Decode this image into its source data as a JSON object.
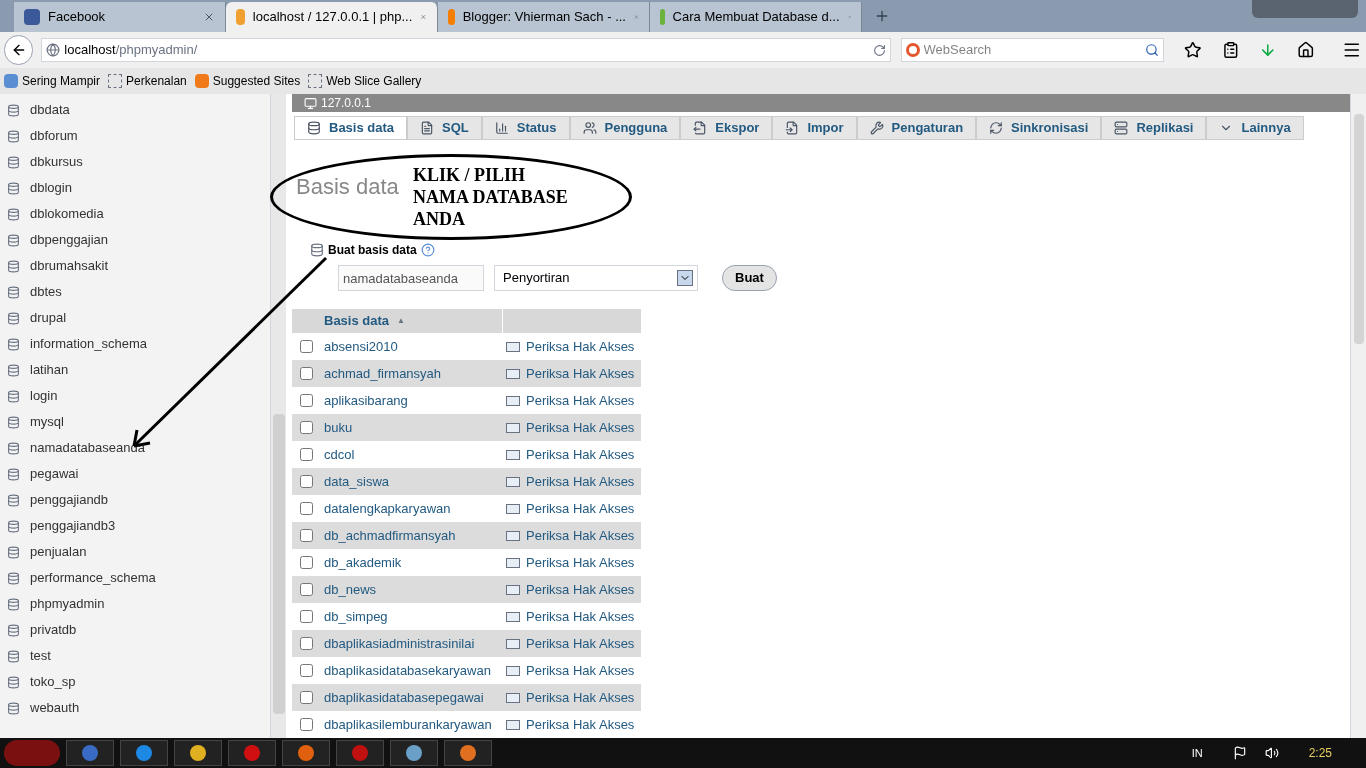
{
  "browser": {
    "tabs": [
      {
        "title": "Facebook",
        "selected": false
      },
      {
        "title": "localhost / 127.0.0.1 | php...",
        "selected": true
      },
      {
        "title": "Blogger: Vhierman Sach - ...",
        "selected": false
      },
      {
        "title": "Cara Membuat Database d...",
        "selected": false
      }
    ],
    "address": {
      "host": "localhost",
      "path": "/phpmyadmin/"
    },
    "search": {
      "placeholder": "WebSearch"
    },
    "bookmarks": [
      "Sering Mampir",
      "Perkenalan",
      "Suggested Sites",
      "Web Slice Gallery"
    ]
  },
  "sidebar": {
    "items": [
      "dbdata",
      "dbforum",
      "dbkursus",
      "dblogin",
      "dblokomedia",
      "dbpenggajian",
      "dbrumahsakit",
      "dbtes",
      "drupal",
      "information_schema",
      "latihan",
      "login",
      "mysql",
      "namadatabaseanda",
      "pegawai",
      "penggajiandb",
      "penggajiandb3",
      "penjualan",
      "performance_schema",
      "phpmyadmin",
      "privatdb",
      "test",
      "toko_sp",
      "webauth"
    ]
  },
  "server": "127.0.0.1",
  "tabs": [
    {
      "label": "Basis data",
      "selected": true
    },
    {
      "label": "SQL",
      "selected": false
    },
    {
      "label": "Status",
      "selected": false
    },
    {
      "label": "Pengguna",
      "selected": false
    },
    {
      "label": "Ekspor",
      "selected": false
    },
    {
      "label": "Impor",
      "selected": false
    },
    {
      "label": "Pengaturan",
      "selected": false
    },
    {
      "label": "Sinkronisasi",
      "selected": false
    },
    {
      "label": "Replikasi",
      "selected": false
    },
    {
      "label": "Lainnya",
      "selected": false
    }
  ],
  "heading": "Basis data",
  "create": {
    "label": "Buat basis data",
    "name_value": "namadatabaseanda",
    "collation": "Penyortiran",
    "button": "Buat"
  },
  "table": {
    "column": "Basis data",
    "sort_indicator": "▲",
    "rows": [
      {
        "name": "absensi2010",
        "checked": false,
        "action": "Periksa Hak Akses"
      },
      {
        "name": "achmad_firmansyah",
        "checked": false,
        "action": "Periksa Hak Akses"
      },
      {
        "name": "aplikasibarang",
        "checked": false,
        "action": "Periksa Hak Akses"
      },
      {
        "name": "buku",
        "checked": false,
        "action": "Periksa Hak Akses"
      },
      {
        "name": "cdcol",
        "checked": false,
        "action": "Periksa Hak Akses"
      },
      {
        "name": "data_siswa",
        "checked": false,
        "action": "Periksa Hak Akses"
      },
      {
        "name": "datalengkapkaryawan",
        "checked": false,
        "action": "Periksa Hak Akses"
      },
      {
        "name": "db_achmadfirmansyah",
        "checked": false,
        "action": "Periksa Hak Akses"
      },
      {
        "name": "db_akademik",
        "checked": false,
        "action": "Periksa Hak Akses"
      },
      {
        "name": "db_news",
        "checked": false,
        "action": "Periksa Hak Akses"
      },
      {
        "name": "db_simpeg",
        "checked": false,
        "action": "Periksa Hak Akses"
      },
      {
        "name": "dbaplikasiadministrasinilai",
        "checked": false,
        "action": "Periksa Hak Akses"
      },
      {
        "name": "dbaplikasidatabasekaryawan",
        "checked": false,
        "action": "Periksa Hak Akses"
      },
      {
        "name": "dbaplikasidatabasepegawai",
        "checked": false,
        "action": "Periksa Hak Akses"
      },
      {
        "name": "dbaplikasilemburankaryawan",
        "checked": false,
        "action": "Periksa Hak Akses"
      }
    ]
  },
  "annotation": [
    "KLIK / PILIH",
    "NAMA DATABASE",
    "ANDA"
  ],
  "taskbar": {
    "language": "IN",
    "time": "2:25"
  }
}
